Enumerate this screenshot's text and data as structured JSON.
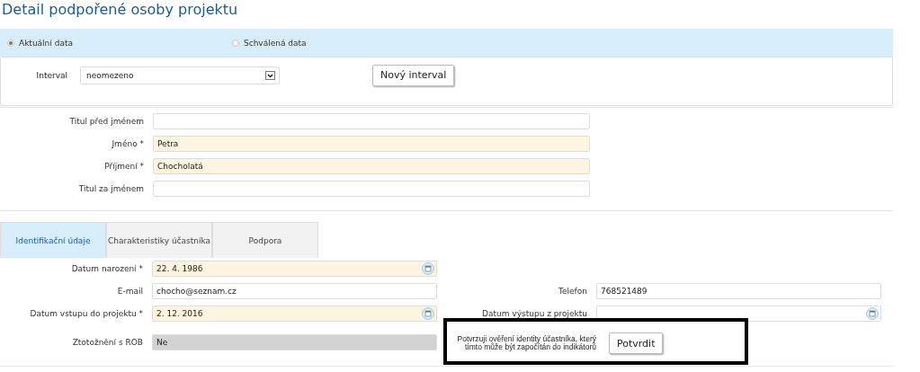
{
  "title": "Detail podpořené osoby projektu",
  "data_source": [
    {
      "label": "Aktuální data",
      "selected": true
    },
    {
      "label": "Schválená data",
      "selected": false
    }
  ],
  "interval": {
    "label": "Interval",
    "value": "neomezeno",
    "button": "Nový interval"
  },
  "name_fields": [
    {
      "label": "Titul před jménem",
      "required": false
    },
    {
      "label": "Jméno *",
      "value": "Petra",
      "required": true
    },
    {
      "label": "Příjmení *",
      "value": "Chocholatá",
      "required": true
    },
    {
      "label": "Titul za jménem",
      "required": false
    }
  ],
  "tabs": [
    {
      "label": "Identifikační údaje",
      "selected": true
    },
    {
      "label": "Charakteristiky účastníka",
      "selected": false
    },
    {
      "label": "Podpora",
      "selected": false
    }
  ],
  "detail_rows": [
    {
      "cells": [
        {
          "kind": "date",
          "label": "Datum narození *",
          "value": "22. 4. 1986",
          "required": true
        }
      ]
    },
    {
      "cells": [
        {
          "kind": "text",
          "label": "E-mail",
          "value": "chocho@seznam.cz",
          "required": false
        },
        {
          "kind": "text",
          "label": "Telefon",
          "value": "768521489",
          "required": false
        }
      ]
    },
    {
      "cells": [
        {
          "kind": "date",
          "label": "Datum vstupu do projektu *",
          "value": "2. 12. 2016",
          "required": true
        },
        {
          "kind": "date",
          "label": "Datum výstupu z projektu",
          "required": false
        }
      ]
    },
    {
      "cells": [
        {
          "kind": "readonly",
          "label": "Ztotožnění s ROB",
          "value": "Ne"
        },
        {
          "kind": "confirm",
          "label": "Potvrzuji ověření identity účastníka, který tímto může být započítán do indikátorů",
          "button": "Potvrdit"
        }
      ]
    }
  ]
}
